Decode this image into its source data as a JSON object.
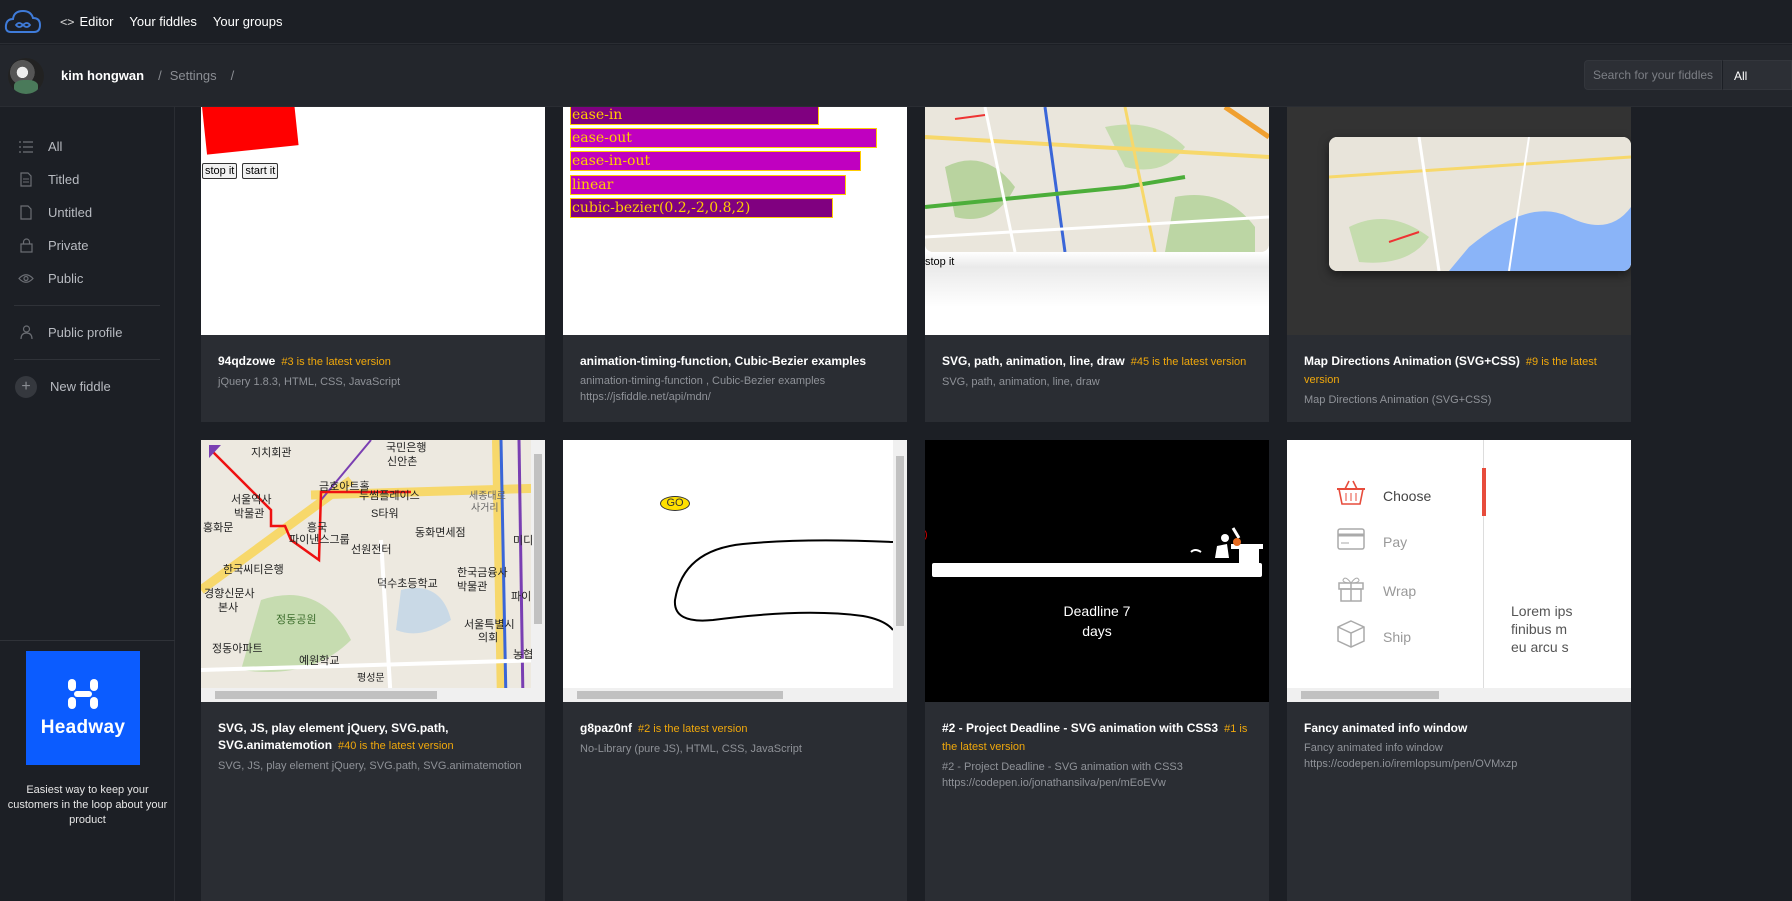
{
  "topbar": {
    "logo_icon": "cloud-infinity-icon",
    "nav": [
      {
        "label": "Editor",
        "icon": "code-icon"
      },
      {
        "label": "Your fiddles"
      },
      {
        "label": "Your groups"
      }
    ]
  },
  "userbar": {
    "username": "kim hongwan",
    "crumb_sep": "/",
    "crumb": "Settings",
    "crumb_sep2": "/",
    "search_placeholder": "Search for your fiddles",
    "filter_value": "All"
  },
  "sidebar": {
    "items": [
      {
        "label": "All",
        "icon": "list-icon"
      },
      {
        "label": "Titled",
        "icon": "document-icon"
      },
      {
        "label": "Untitled",
        "icon": "blank-document-icon"
      },
      {
        "label": "Private",
        "icon": "lock-icon"
      },
      {
        "label": "Public",
        "icon": "eye-icon"
      }
    ],
    "profile": {
      "label": "Public profile",
      "icon": "user-icon"
    },
    "new_fiddle": {
      "label": "New fiddle",
      "icon": "plus-icon"
    },
    "ad": {
      "brand": "Headway",
      "text": "Easiest way to keep your customers in the loop about your product",
      "bg": "#0b5cff"
    }
  },
  "cards": [
    {
      "title": "94qdzowe",
      "version": "#3 is the latest version",
      "desc": "jQuery 1.8.3, HTML, CSS, JavaScript",
      "preview": {
        "btn1": "stop it",
        "btn2": "start it"
      }
    },
    {
      "title": "animation-timing-function, Cubic-Bezier examples",
      "version": "",
      "desc": "animation-timing-function , Cubic-Bezier examples",
      "desc2": "https://jsfiddle.net/api/mdn/",
      "preview": {
        "bars": [
          "ease-in",
          "ease-out",
          "ease-in-out",
          "linear",
          "cubic-bezier(0.2,-2,0.8,2)"
        ]
      }
    },
    {
      "title": "SVG, path, animation, line, draw",
      "version": "#45 is the latest version",
      "desc": "SVG, path, animation, line, draw",
      "preview": {
        "btn": "stop it"
      }
    },
    {
      "title": "Map Directions Animation (SVG+CSS)",
      "version": "#9 is the latest version",
      "desc": "Map Directions Animation (SVG+CSS)"
    },
    {
      "title": "SVG, JS, play element jQuery, SVG.path, SVG.animatemotion",
      "version": "#40 is the latest version",
      "desc": "SVG, JS, play element jQuery, SVG.path, SVG.animatemotion",
      "preview": {
        "labels": [
          "국민은행",
          "신안촌",
          "금호아트홀",
          "두썸플레이스",
          "서울역사",
          "박물관",
          "S타워",
          "홍화문",
          "흥국",
          "파이낸스그룹",
          "동화면세점",
          "세종대로",
          "사거리",
          "한국씨티은행",
          "선원전터",
          "경향신문사",
          "본사",
          "덕수초등학교",
          "한국금융사",
          "박물관",
          "정동공원",
          "정동아파트",
          "예원학교",
          "서울특별시",
          "의회",
          "평성문",
          "지치회관",
          "미디",
          "파이",
          "농협"
        ]
      }
    },
    {
      "title": "g8paz0nf",
      "version": "#2 is the latest version",
      "desc": "No-Library (pure JS), HTML, CSS, JavaScript",
      "preview": {
        "go": "GO"
      }
    },
    {
      "title": "#2 - Project Deadline - SVG animation with CSS3",
      "version": "#1 is the latest version",
      "desc": "#2 - Project Deadline - SVG animation with CSS3",
      "desc2": "https://codepen.io/jonathansilva/pen/mEoEVw",
      "preview": {
        "line1": "Deadline 7",
        "line2": "days"
      }
    },
    {
      "title": "Fancy animated info window",
      "version": "",
      "desc": "Fancy animated info window",
      "desc2": "https://codepen.io/iremlopsum/pen/OVMxzp",
      "preview": {
        "items": [
          {
            "label": "Choose",
            "icon": "basket-icon"
          },
          {
            "label": "Pay",
            "icon": "credit-card-icon"
          },
          {
            "label": "Wrap",
            "icon": "gift-icon"
          },
          {
            "label": "Ship",
            "icon": "box-icon"
          }
        ],
        "lorem": [
          "Lorem ips",
          "finibus m",
          "eu arcu s"
        ],
        "accent": "#e74c3c"
      }
    }
  ]
}
